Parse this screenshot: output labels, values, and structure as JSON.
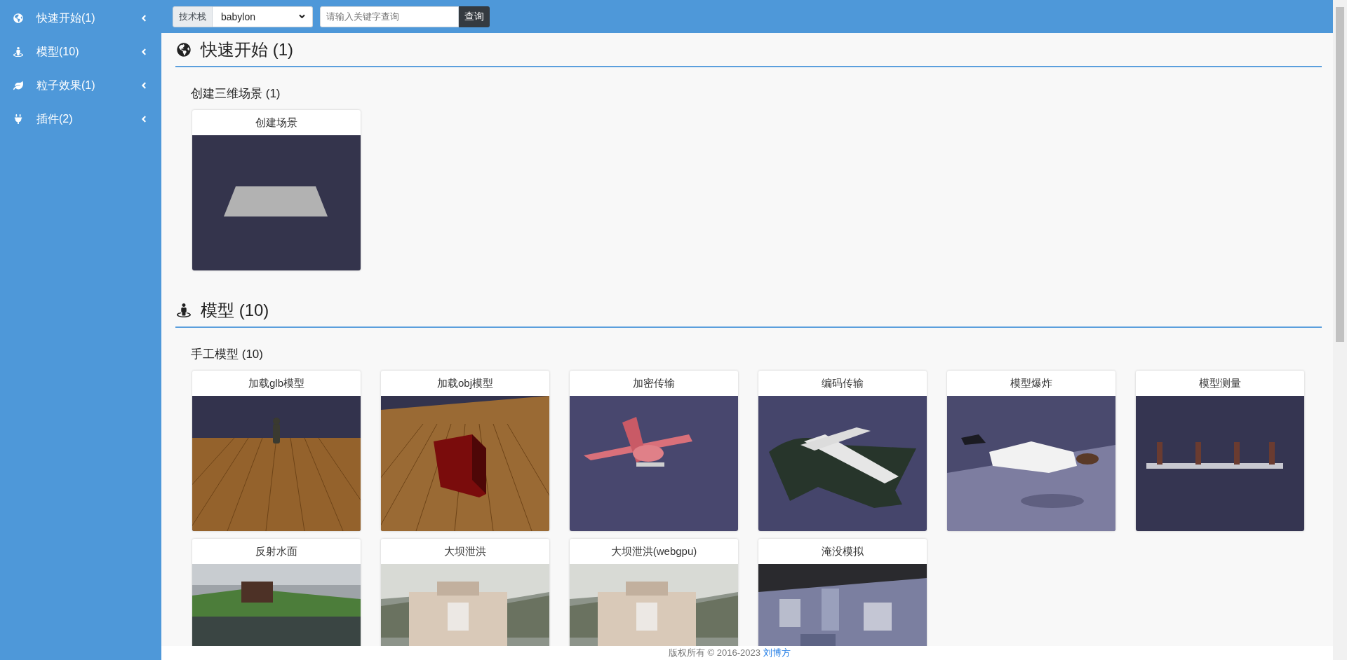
{
  "sidebar": {
    "items": [
      {
        "label": "快速开始(1)",
        "expanded": false
      },
      {
        "label": "模型(10)",
        "expanded": false
      },
      {
        "label": "粒子效果(1)",
        "expanded": false
      },
      {
        "label": "插件(2)",
        "expanded": false
      }
    ]
  },
  "toolbar": {
    "stack_label": "技术栈",
    "stack_value": "babylon",
    "search": {
      "placeholder": "请输入关键字查询"
    },
    "search_button": "查询"
  },
  "sections": [
    {
      "title": "快速开始 (1)",
      "groups": [
        {
          "title": "创建三维场景 (1)",
          "cards": [
            {
              "title": "创建场景"
            }
          ]
        }
      ]
    },
    {
      "title": "模型 (10)",
      "groups": [
        {
          "title": "手工模型 (10)",
          "cards": [
            {
              "title": "加载glb模型"
            },
            {
              "title": "加载obj模型"
            },
            {
              "title": "加密传输"
            },
            {
              "title": "编码传输"
            },
            {
              "title": "模型爆炸"
            },
            {
              "title": "模型测量"
            },
            {
              "title": "反射水面"
            },
            {
              "title": "大坝泄洪"
            },
            {
              "title": "大坝泄洪(webgpu)"
            },
            {
              "title": "淹没模拟"
            }
          ]
        }
      ]
    }
  ],
  "footer": {
    "text": "版权所有 © 2016-2023",
    "author": "刘博方"
  }
}
